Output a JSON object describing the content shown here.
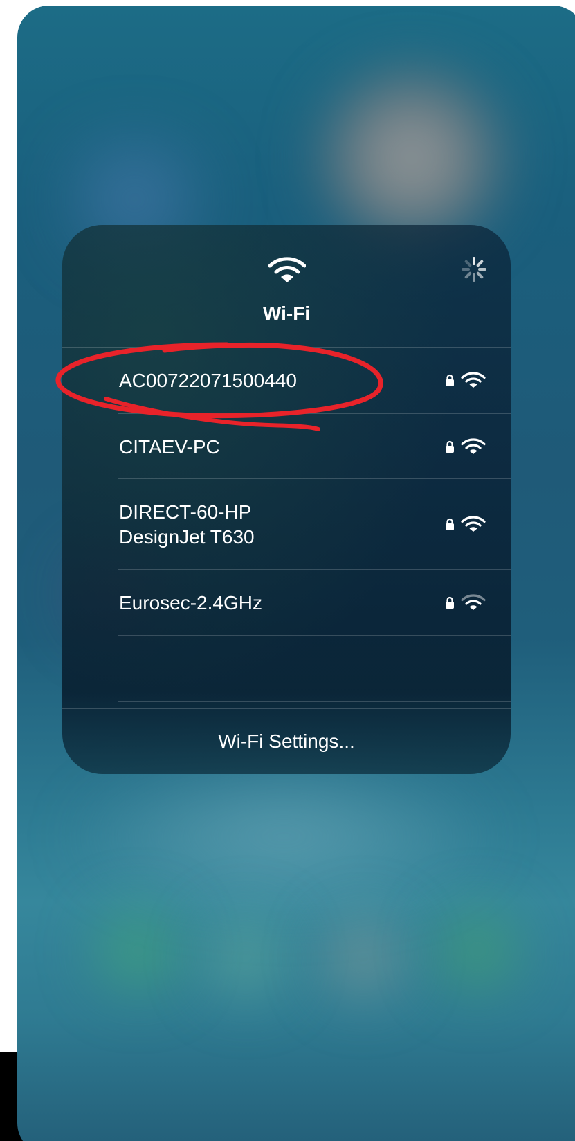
{
  "panel": {
    "title": "Wi-Fi",
    "networks": [
      {
        "name": "AC00722071500440",
        "secured": true,
        "signal": "full"
      },
      {
        "name": "CITAEV-PC",
        "secured": true,
        "signal": "full"
      },
      {
        "name_line1": "DIRECT-60-HP",
        "name_line2": "DesignJet T630",
        "secured": true,
        "signal": "full"
      },
      {
        "name": "Eurosec-2.4GHz",
        "secured": true,
        "signal": "medium"
      }
    ],
    "settings_label": "Wi-Fi Settings..."
  },
  "icons": {
    "header": "wifi-icon",
    "loading": "spinner-icon",
    "secured": "lock-icon",
    "signal": "wifi-signal-icon"
  },
  "colors": {
    "annotation": "#e8232a",
    "text": "#ffffff"
  }
}
